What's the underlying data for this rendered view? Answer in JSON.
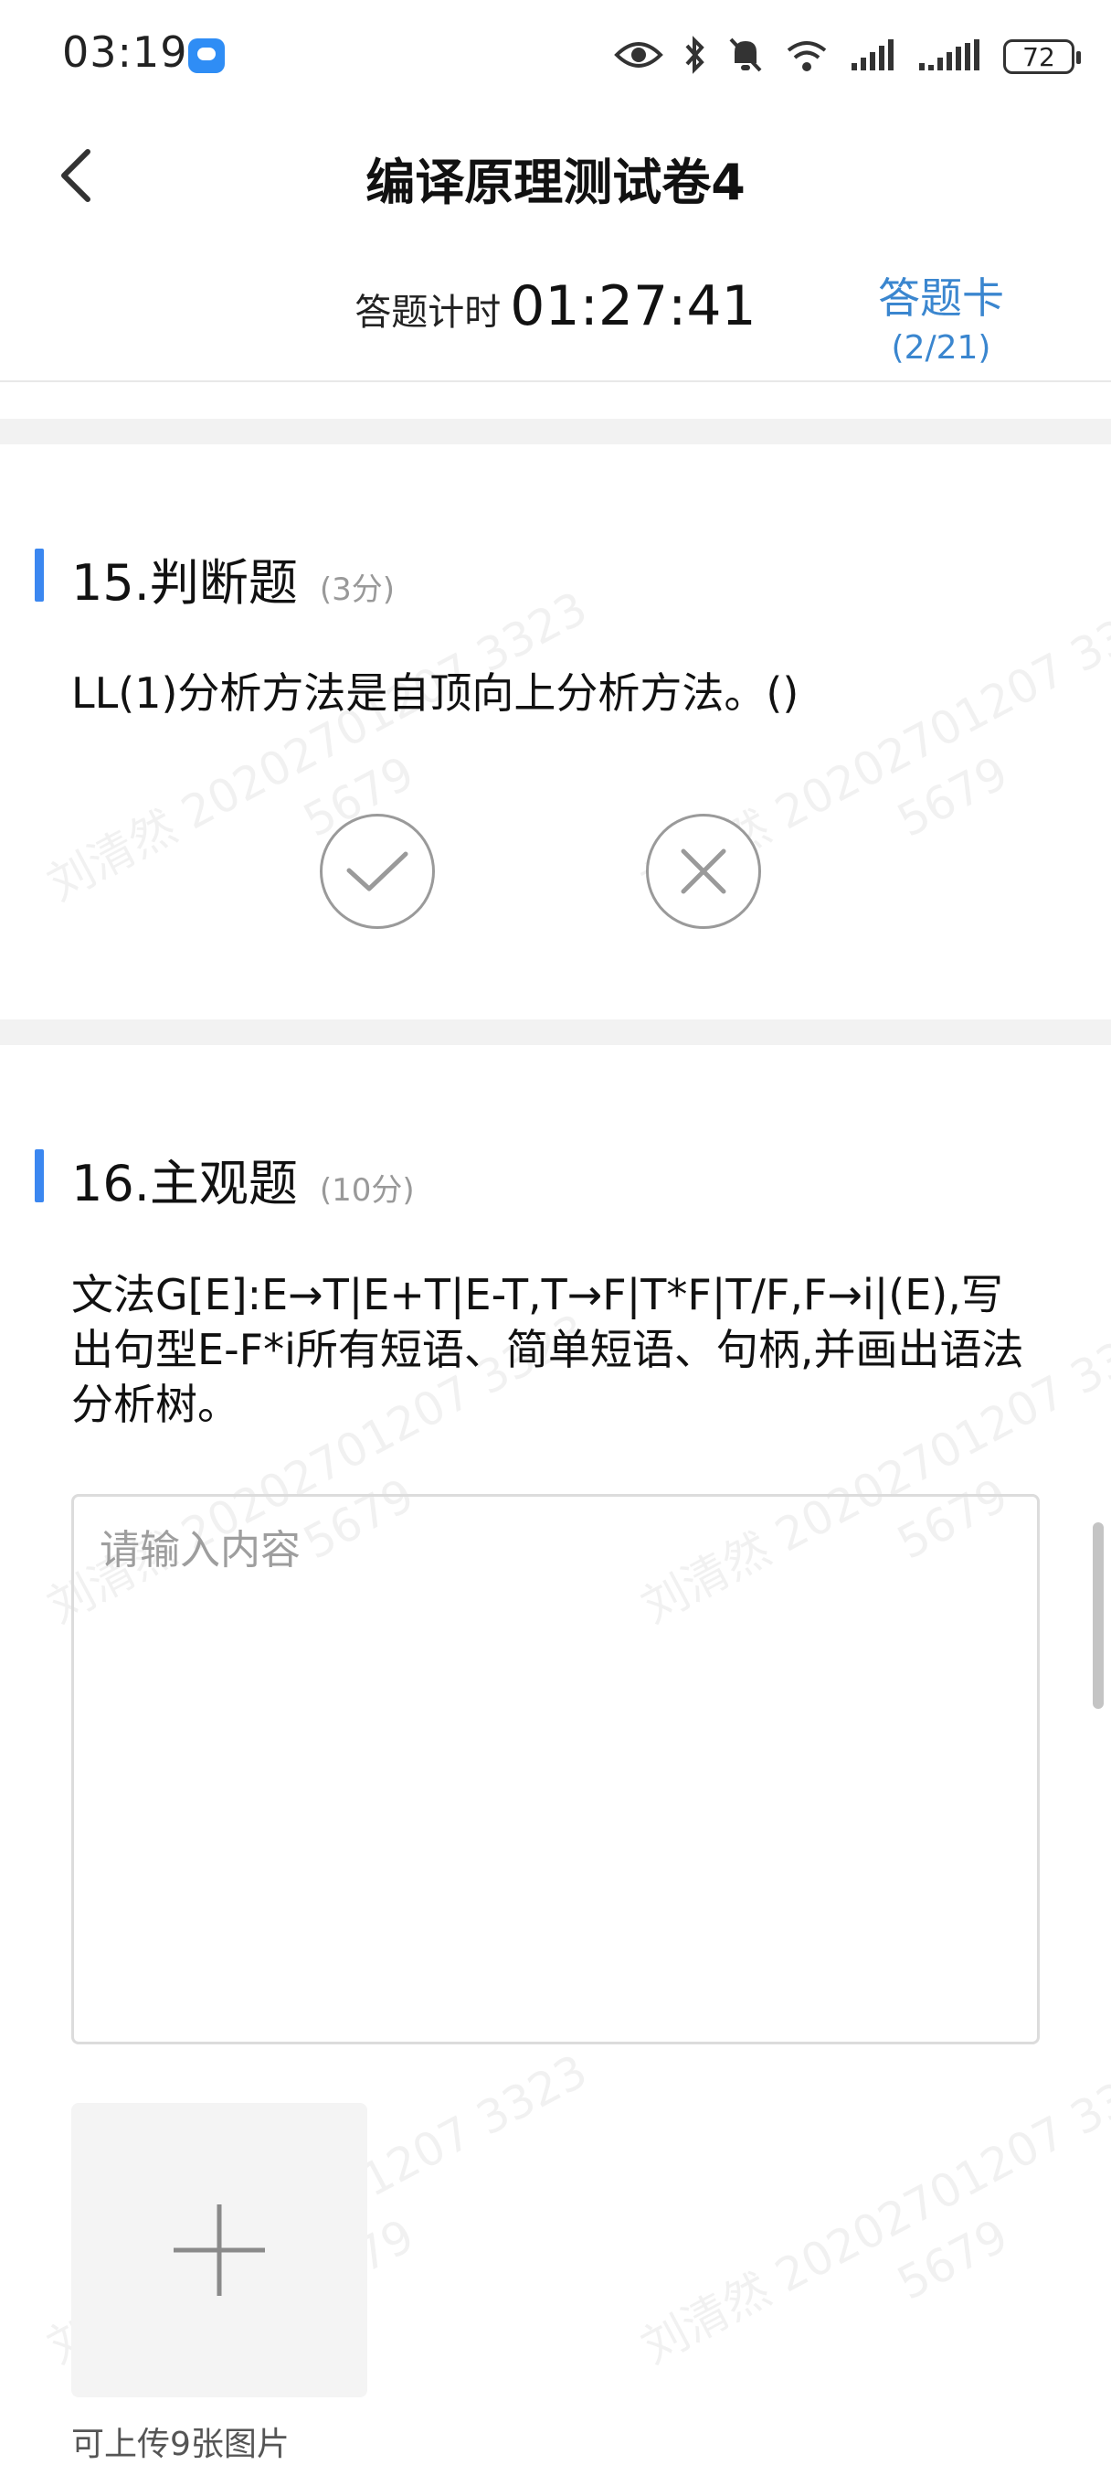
{
  "status_bar": {
    "time": "03:19",
    "battery": "72",
    "icons": [
      "message-app-icon",
      "eye-icon",
      "bluetooth-icon",
      "bell-off-icon",
      "wifi-icon",
      "signal-icon",
      "signal-icon-2",
      "battery-icon"
    ]
  },
  "header": {
    "title": "编译原理测试卷4",
    "timer_label": "答题计时",
    "timer_value": "01:27:41",
    "answer_card_label": "答题卡",
    "answer_card_count": "(2/21)"
  },
  "questions": [
    {
      "title": "15.判断题",
      "score": "(3分)",
      "text": "LL(1)分析方法是自顶向上分析方法。()",
      "options": [
        "true-icon",
        "false-icon"
      ]
    },
    {
      "title": "16.主观题",
      "score": "(10分)",
      "text": "文法G[E]:E→T|E+T|E-T,T→F|T*F|T/F,F→i|(E),写出句型E-F*i所有短语、简单短语、句柄,并画出语法分析树。",
      "placeholder": "请输入内容",
      "upload_hint": "可上传9张图片"
    }
  ],
  "watermark": {
    "line1": "刘清然 20202701207 3323",
    "line2": "5679"
  },
  "colors": {
    "accent": "#3b87f0",
    "link": "#3a86cf",
    "band": "#f2f2f2"
  }
}
